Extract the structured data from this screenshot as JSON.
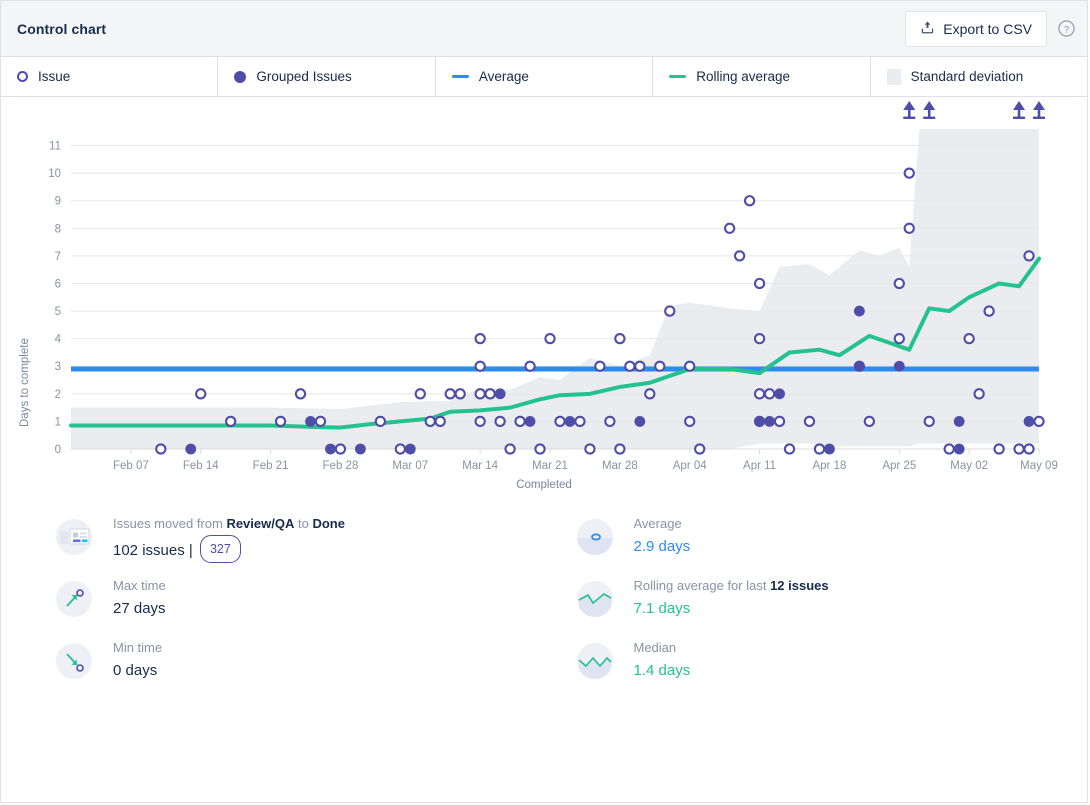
{
  "header": {
    "title": "Control chart",
    "export_label": "Export to CSV",
    "export_icon": "upload-icon",
    "help_icon": "help-circle-icon"
  },
  "legend": [
    {
      "label": "Issue",
      "marker": "hollow-circle",
      "color": "#4e4ea8"
    },
    {
      "label": "Grouped Issues",
      "marker": "solid-circle",
      "color": "#4e4ea8"
    },
    {
      "label": "Average",
      "marker": "line",
      "color": "#2d8bf0"
    },
    {
      "label": "Rolling average",
      "marker": "line",
      "color": "#24c38e"
    },
    {
      "label": "Standard deviation",
      "marker": "square",
      "color": "#ebecef"
    }
  ],
  "stats": {
    "left": [
      {
        "icon": "board-icon",
        "label_prefix": "Issues moved from ",
        "label_bold1": "Review/QA",
        "label_mid": " to ",
        "label_bold2": "Done",
        "value": "102 issues | ",
        "pill": "327"
      },
      {
        "icon": "arrow-up-right-icon",
        "label": "Max time",
        "value": "27 days"
      },
      {
        "icon": "arrow-down-right-icon",
        "label": "Min time",
        "value": "0 days"
      }
    ],
    "right": [
      {
        "icon": "average-dot-icon",
        "label": "Average",
        "value": "2.9 days",
        "color": "blue"
      },
      {
        "icon": "rolling-average-icon",
        "label_prefix": "Rolling average for last ",
        "label_bold": "12 issues",
        "value": "7.1 days",
        "color": "green"
      },
      {
        "icon": "median-icon",
        "label": "Median",
        "value": "1.4 days",
        "color": "green"
      }
    ]
  },
  "chart_data": {
    "type": "scatter",
    "title": "Control chart",
    "xlabel": "Completed",
    "ylabel": "Days to complete",
    "ylim": [
      0,
      11.6
    ],
    "yticks": [
      0,
      1,
      2,
      3,
      4,
      5,
      6,
      7,
      8,
      9,
      10,
      11
    ],
    "grid": true,
    "xlim_days": [
      0,
      97
    ],
    "xticks": [
      {
        "label": "Feb 07",
        "day": 6
      },
      {
        "label": "Feb 14",
        "day": 13
      },
      {
        "label": "Feb 21",
        "day": 20
      },
      {
        "label": "Feb 28",
        "day": 27
      },
      {
        "label": "Mar 07",
        "day": 34
      },
      {
        "label": "Mar 14",
        "day": 41
      },
      {
        "label": "Mar 21",
        "day": 48
      },
      {
        "label": "Mar 28",
        "day": 55
      },
      {
        "label": "Apr 04",
        "day": 62
      },
      {
        "label": "Apr 11",
        "day": 69
      },
      {
        "label": "Apr 18",
        "day": 76
      },
      {
        "label": "Apr 25",
        "day": 83
      },
      {
        "label": "May 02",
        "day": 90
      },
      {
        "label": "May 09",
        "day": 97
      }
    ],
    "average": {
      "name": "Average",
      "value": 2.9,
      "color": "#2d8bf0"
    },
    "rolling_average": {
      "name": "Rolling average",
      "color": "#24c38e",
      "points": [
        {
          "day": 0,
          "y": 0.85
        },
        {
          "day": 13,
          "y": 0.85
        },
        {
          "day": 20,
          "y": 0.85
        },
        {
          "day": 24,
          "y": 0.8
        },
        {
          "day": 27,
          "y": 0.78
        },
        {
          "day": 30,
          "y": 0.9
        },
        {
          "day": 33,
          "y": 1.0
        },
        {
          "day": 36,
          "y": 1.1
        },
        {
          "day": 38,
          "y": 1.35
        },
        {
          "day": 41,
          "y": 1.4
        },
        {
          "day": 44,
          "y": 1.5
        },
        {
          "day": 47,
          "y": 1.8
        },
        {
          "day": 49,
          "y": 1.95
        },
        {
          "day": 52,
          "y": 2.0
        },
        {
          "day": 55,
          "y": 2.25
        },
        {
          "day": 58,
          "y": 2.4
        },
        {
          "day": 62,
          "y": 2.9
        },
        {
          "day": 66,
          "y": 2.9
        },
        {
          "day": 69,
          "y": 2.75
        },
        {
          "day": 72,
          "y": 3.5
        },
        {
          "day": 75,
          "y": 3.6
        },
        {
          "day": 77,
          "y": 3.4
        },
        {
          "day": 80,
          "y": 4.1
        },
        {
          "day": 82,
          "y": 3.85
        },
        {
          "day": 84,
          "y": 3.6
        },
        {
          "day": 86,
          "y": 5.1
        },
        {
          "day": 88,
          "y": 5.0
        },
        {
          "day": 90,
          "y": 5.5
        },
        {
          "day": 93,
          "y": 6.0
        },
        {
          "day": 95,
          "y": 5.9
        },
        {
          "day": 97,
          "y": 6.9
        }
      ]
    },
    "standard_deviation": {
      "name": "Standard deviation",
      "color": "#ebecef",
      "band": [
        {
          "day": 0,
          "low": 0.0,
          "high": 1.5
        },
        {
          "day": 20,
          "low": 0.0,
          "high": 1.5
        },
        {
          "day": 27,
          "low": 0.0,
          "high": 1.45
        },
        {
          "day": 33,
          "low": 0.0,
          "high": 1.7
        },
        {
          "day": 38,
          "low": 0.0,
          "high": 1.75
        },
        {
          "day": 41,
          "low": 0.0,
          "high": 2.2
        },
        {
          "day": 44,
          "low": 0.0,
          "high": 2.15
        },
        {
          "day": 47,
          "low": 0.0,
          "high": 2.6
        },
        {
          "day": 49,
          "low": 0.0,
          "high": 2.5
        },
        {
          "day": 52,
          "low": 0.0,
          "high": 3.3
        },
        {
          "day": 55,
          "low": 0.0,
          "high": 3.0
        },
        {
          "day": 58,
          "low": 0.0,
          "high": 3.4
        },
        {
          "day": 60,
          "low": 0.0,
          "high": 5.2
        },
        {
          "day": 62,
          "low": 0.0,
          "high": 5.3
        },
        {
          "day": 66,
          "low": 0.0,
          "high": 5.1
        },
        {
          "day": 69,
          "low": 0.2,
          "high": 5.0
        },
        {
          "day": 71,
          "low": 0.2,
          "high": 6.6
        },
        {
          "day": 74,
          "low": 0.2,
          "high": 6.7
        },
        {
          "day": 76,
          "low": 0.1,
          "high": 6.3
        },
        {
          "day": 79,
          "low": 0.1,
          "high": 7.2
        },
        {
          "day": 81,
          "low": 0.1,
          "high": 7.0
        },
        {
          "day": 83,
          "low": 0.1,
          "high": 7.3
        },
        {
          "day": 84,
          "low": 0.1,
          "high": 6.6
        },
        {
          "day": 85,
          "low": 0.2,
          "high": 11.6
        },
        {
          "day": 90,
          "low": 0.2,
          "high": 11.6
        },
        {
          "day": 92,
          "low": 0.2,
          "high": 11.9
        },
        {
          "day": 97,
          "low": 0.2,
          "high": 11.9
        }
      ]
    },
    "series": [
      {
        "name": "Issue",
        "marker": "hollow-circle",
        "color": "#4e4ea8",
        "points": [
          {
            "day": 9,
            "y": 0
          },
          {
            "day": 13,
            "y": 2
          },
          {
            "day": 16,
            "y": 1
          },
          {
            "day": 21,
            "y": 1
          },
          {
            "day": 23,
            "y": 2
          },
          {
            "day": 25,
            "y": 1
          },
          {
            "day": 27,
            "y": 0
          },
          {
            "day": 31,
            "y": 1
          },
          {
            "day": 33,
            "y": 0
          },
          {
            "day": 35,
            "y": 2
          },
          {
            "day": 36,
            "y": 1
          },
          {
            "day": 37,
            "y": 1
          },
          {
            "day": 38,
            "y": 2
          },
          {
            "day": 39,
            "y": 2
          },
          {
            "day": 41,
            "y": 2
          },
          {
            "day": 42,
            "y": 2
          },
          {
            "day": 41,
            "y": 4
          },
          {
            "day": 41,
            "y": 3
          },
          {
            "day": 41,
            "y": 1
          },
          {
            "day": 43,
            "y": 1
          },
          {
            "day": 44,
            "y": 0
          },
          {
            "day": 45,
            "y": 1
          },
          {
            "day": 46,
            "y": 3
          },
          {
            "day": 47,
            "y": 0
          },
          {
            "day": 48,
            "y": 4
          },
          {
            "day": 49,
            "y": 1
          },
          {
            "day": 51,
            "y": 1
          },
          {
            "day": 52,
            "y": 0
          },
          {
            "day": 53,
            "y": 3
          },
          {
            "day": 54,
            "y": 1
          },
          {
            "day": 55,
            "y": 4
          },
          {
            "day": 55,
            "y": 0
          },
          {
            "day": 56,
            "y": 3
          },
          {
            "day": 57,
            "y": 3
          },
          {
            "day": 58,
            "y": 2
          },
          {
            "day": 59,
            "y": 3
          },
          {
            "day": 60,
            "y": 5
          },
          {
            "day": 62,
            "y": 1
          },
          {
            "day": 62,
            "y": 3
          },
          {
            "day": 63,
            "y": 0
          },
          {
            "day": 66,
            "y": 8
          },
          {
            "day": 67,
            "y": 7
          },
          {
            "day": 68,
            "y": 9
          },
          {
            "day": 69,
            "y": 6
          },
          {
            "day": 69,
            "y": 4
          },
          {
            "day": 69,
            "y": 2
          },
          {
            "day": 69,
            "y": 1
          },
          {
            "day": 70,
            "y": 2
          },
          {
            "day": 71,
            "y": 1
          },
          {
            "day": 72,
            "y": 0
          },
          {
            "day": 74,
            "y": 1
          },
          {
            "day": 75,
            "y": 0
          },
          {
            "day": 79,
            "y": 3
          },
          {
            "day": 80,
            "y": 1
          },
          {
            "day": 83,
            "y": 6
          },
          {
            "day": 83,
            "y": 4
          },
          {
            "day": 84,
            "y": 10
          },
          {
            "day": 84,
            "y": 8
          },
          {
            "day": 86,
            "y": 1
          },
          {
            "day": 88,
            "y": 0
          },
          {
            "day": 90,
            "y": 4
          },
          {
            "day": 91,
            "y": 2
          },
          {
            "day": 92,
            "y": 5
          },
          {
            "day": 93,
            "y": 0
          },
          {
            "day": 95,
            "y": 0
          },
          {
            "day": 96,
            "y": 0
          },
          {
            "day": 96,
            "y": 7
          },
          {
            "day": 97,
            "y": 1
          }
        ]
      },
      {
        "name": "Grouped Issues",
        "marker": "solid-circle",
        "color": "#4e4ea8",
        "points": [
          {
            "day": 12,
            "y": 0
          },
          {
            "day": 24,
            "y": 1
          },
          {
            "day": 26,
            "y": 0
          },
          {
            "day": 29,
            "y": 0
          },
          {
            "day": 34,
            "y": 0
          },
          {
            "day": 43,
            "y": 2
          },
          {
            "day": 46,
            "y": 1
          },
          {
            "day": 50,
            "y": 1
          },
          {
            "day": 57,
            "y": 1
          },
          {
            "day": 69,
            "y": 1
          },
          {
            "day": 70,
            "y": 1
          },
          {
            "day": 71,
            "y": 2
          },
          {
            "day": 76,
            "y": 0
          },
          {
            "day": 79,
            "y": 5
          },
          {
            "day": 79,
            "y": 3
          },
          {
            "day": 83,
            "y": 3
          },
          {
            "day": 89,
            "y": 1
          },
          {
            "day": 89,
            "y": 0
          },
          {
            "day": 96,
            "y": 1
          }
        ]
      }
    ],
    "out_of_range_markers": {
      "name": "Above range",
      "marker": "up-arrow",
      "color": "#4e4ea8",
      "days": [
        84,
        86,
        95,
        97
      ]
    }
  }
}
